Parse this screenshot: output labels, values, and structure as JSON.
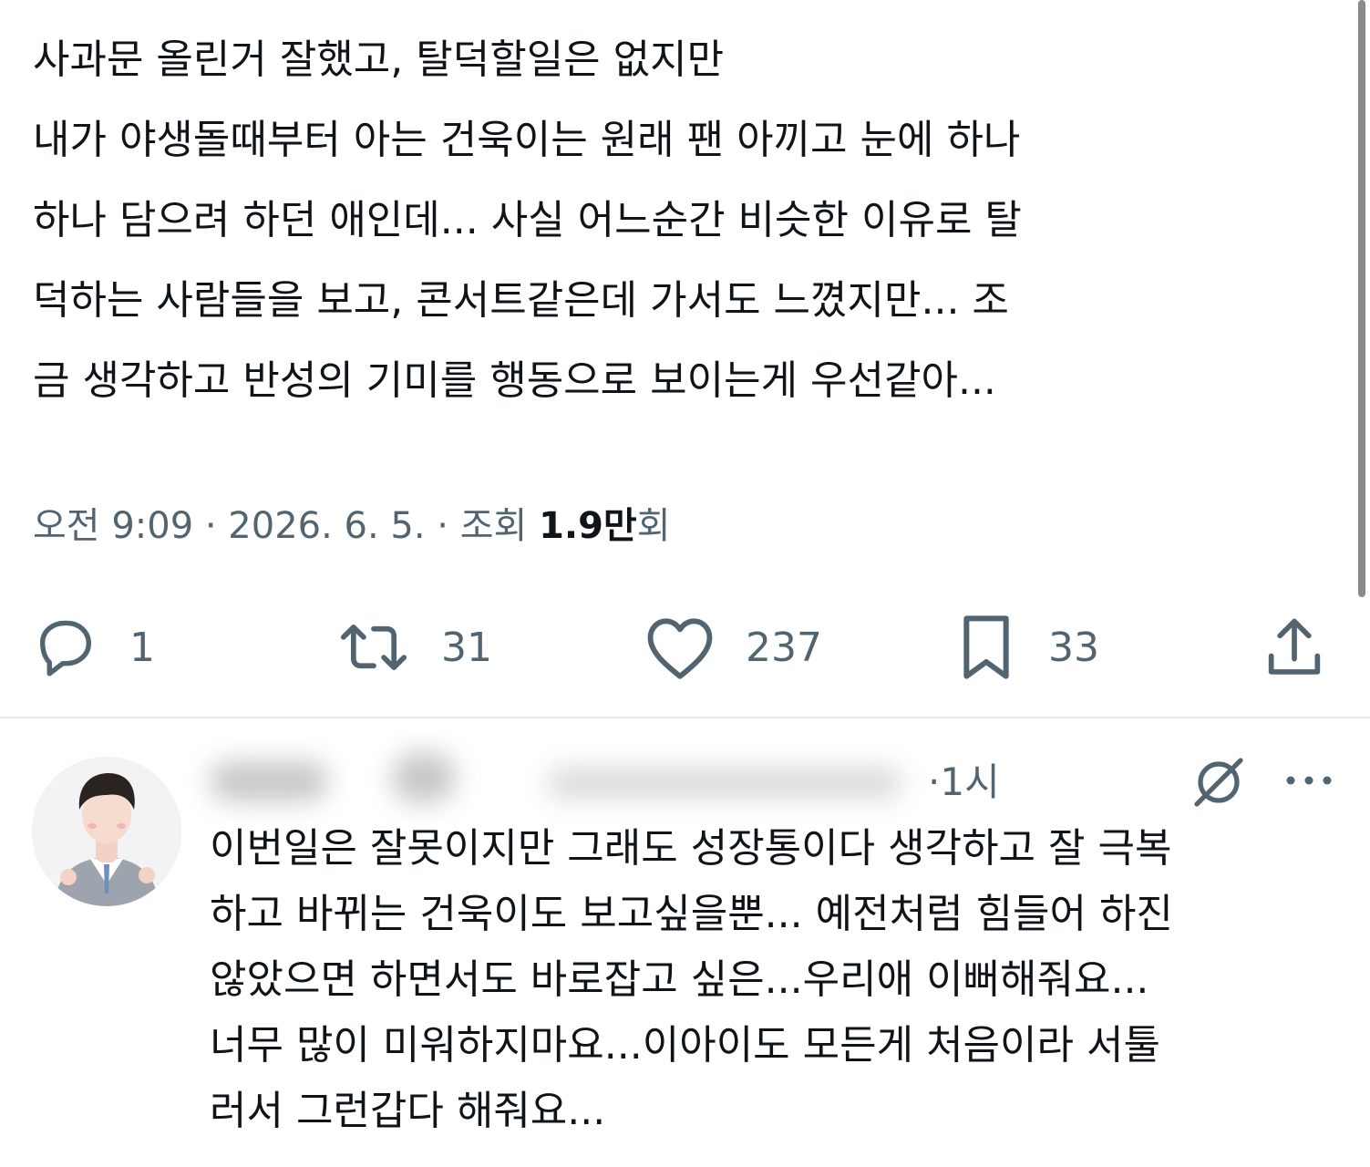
{
  "tweet": {
    "text": "사과문 올린거 잘했고, 탈덕할일은 없지만\n내가 야생돌때부터 아는 건욱이는 원래 팬 아끼고 눈에 하나\n하나 담으려 하던 애인데... 사실 어느순간 비슷한 이유로 탈\n덕하는 사람들을 보고, 콘서트같은데 가서도 느꼈지만... 조\n금 생각하고 반성의 기미를 행동으로 보이는게 우선같아...",
    "time": "오전 9:09",
    "separator": "·",
    "date": "2026. 6. 5.",
    "views_label": "조회",
    "views_number": "1.9만",
    "views_suffix": "회"
  },
  "actions": {
    "reply": {
      "icon": "reply-icon",
      "count": "1"
    },
    "retweet": {
      "icon": "retweet-icon",
      "count": "31"
    },
    "like": {
      "icon": "heart-icon",
      "count": "237"
    },
    "bookmark": {
      "icon": "bookmark-icon",
      "count": "33"
    },
    "share": {
      "icon": "share-icon"
    }
  },
  "reply": {
    "time": "·1시",
    "text": "이번일은 잘못이지만 그래도 성장통이다 생각하고 잘 극복\n하고 바뀌는 건욱이도 보고싶을뿐... 예전처럼 힘들어 하진\n않았으면 하면서도 바로잡고 싶은...우리애 이뻐해줘요...\n너무 많이 미워하지마요...이아이도 모든게 처음이라 서툴\n러서 그런갑다 해줘요..."
  },
  "colors": {
    "text": "#0f1419",
    "secondary": "#536471",
    "divider": "#e6e9ec"
  }
}
